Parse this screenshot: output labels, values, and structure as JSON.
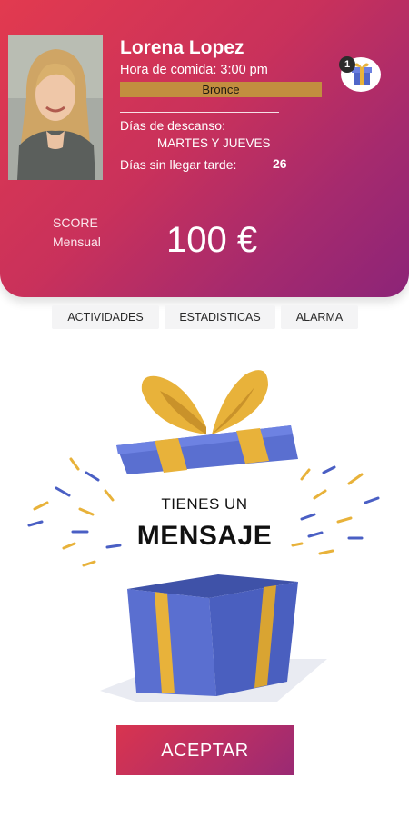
{
  "profile": {
    "name": "Lorena Lopez",
    "meal_time": "Hora de comida: 3:00 pm",
    "level": "Bronce",
    "rest_label": "Días de descanso:",
    "rest_days": "MARTES Y JUEVES",
    "late_label": "Días sin llegar tarde:",
    "late_value": "26"
  },
  "notifications": {
    "gift_count": "1",
    "icon": "gift-icon"
  },
  "score": {
    "label_line1": "SCORE",
    "label_line2": "Mensual",
    "value": "100 €"
  },
  "tabs": [
    {
      "label": "ACTIVIDADES"
    },
    {
      "label": "ESTADISTICAS"
    },
    {
      "label": "ALARMA"
    }
  ],
  "message": {
    "line1": "TIENES UN",
    "line2": "MENSAJE"
  },
  "actions": {
    "accept_label": "ACEPTAR"
  },
  "colors": {
    "header_start": "#e23a4f",
    "header_end": "#8c2478",
    "level_badge": "#c28e3f",
    "gift_blue": "#5a6fd0",
    "ribbon_gold": "#e8b23a"
  }
}
